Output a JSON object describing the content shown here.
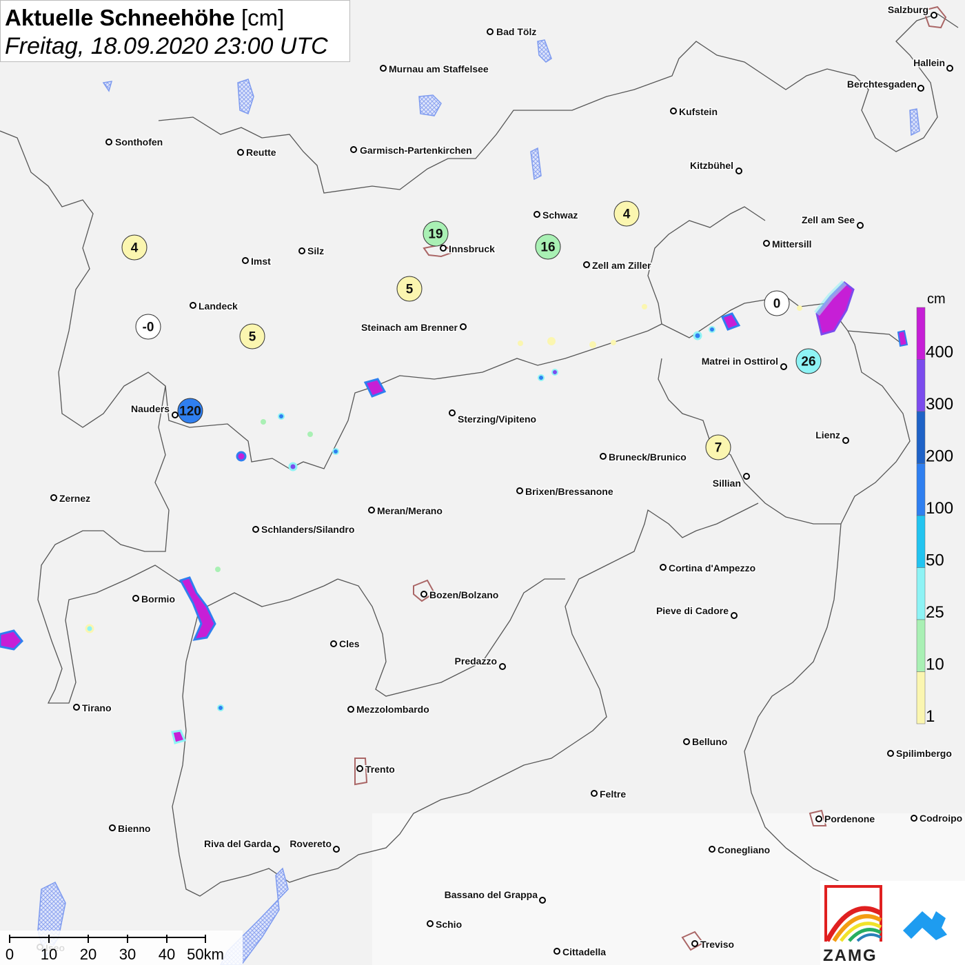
{
  "title": {
    "main_bold": "Aktuelle Schneehöhe",
    "main_unit": "[cm]",
    "subtitle": "Freitag, 18.09.2020 23:00 UTC"
  },
  "cities": [
    {
      "name": "Salzburg"
    },
    {
      "name": "Bad Tölz"
    },
    {
      "name": "Hallein"
    },
    {
      "name": "Murnau am Staffelsee"
    },
    {
      "name": "Berchtesgaden"
    },
    {
      "name": "Kufstein"
    },
    {
      "name": "Sonthofen"
    },
    {
      "name": "Reutte"
    },
    {
      "name": "Garmisch-Partenkirchen"
    },
    {
      "name": "Kitzbühel"
    },
    {
      "name": "Schwaz"
    },
    {
      "name": "Zell am See"
    },
    {
      "name": "Innsbruck"
    },
    {
      "name": "Mittersill"
    },
    {
      "name": "Silz"
    },
    {
      "name": "Imst"
    },
    {
      "name": "Zell am Ziller"
    },
    {
      "name": "Landeck"
    },
    {
      "name": "Steinach am Brenner"
    },
    {
      "name": "Matrei in Osttirol"
    },
    {
      "name": "Nauders"
    },
    {
      "name": "Sterzing/Vipiteno"
    },
    {
      "name": "Lienz"
    },
    {
      "name": "Bruneck/Brunico"
    },
    {
      "name": "Sillian"
    },
    {
      "name": "Zernez"
    },
    {
      "name": "Brixen/Bressanone"
    },
    {
      "name": "Meran/Merano"
    },
    {
      "name": "Schlanders/Silandro"
    },
    {
      "name": "Cortina d'Ampezzo"
    },
    {
      "name": "Bozen/Bolzano"
    },
    {
      "name": "Bormio"
    },
    {
      "name": "Pieve di Cadore"
    },
    {
      "name": "Cles"
    },
    {
      "name": "Predazzo"
    },
    {
      "name": "Tirano"
    },
    {
      "name": "Mezzolombardo"
    },
    {
      "name": "Belluno"
    },
    {
      "name": "Spilimbergo"
    },
    {
      "name": "Trento"
    },
    {
      "name": "Feltre"
    },
    {
      "name": "Pordenone"
    },
    {
      "name": "Codroipo"
    },
    {
      "name": "Bienno"
    },
    {
      "name": "Riva del Garda"
    },
    {
      "name": "Rovereto"
    },
    {
      "name": "Conegliano"
    },
    {
      "name": "Bassano del Grappa"
    },
    {
      "name": "Schio"
    },
    {
      "name": "Iseo"
    },
    {
      "name": "Treviso"
    },
    {
      "name": "Cittadella"
    }
  ],
  "stations": [
    {
      "value": "19",
      "color": "#a9f0b4"
    },
    {
      "value": "16",
      "color": "#a9f0b4"
    },
    {
      "value": "4",
      "color": "#fbf6b0"
    },
    {
      "value": "4",
      "color": "#fbf6b0"
    },
    {
      "value": "5",
      "color": "#fbf6b0"
    },
    {
      "value": "-0",
      "color": "#ffffff"
    },
    {
      "value": "5",
      "color": "#fbf6b0"
    },
    {
      "value": "0",
      "color": "#ffffff"
    },
    {
      "value": "26",
      "color": "#8ef3f5"
    },
    {
      "value": "120",
      "color": "#2f7ff0"
    },
    {
      "value": "7",
      "color": "#fbf6b0"
    }
  ],
  "legend": {
    "unit": "cm",
    "bins": [
      {
        "label": "400",
        "color": "#c61fd6"
      },
      {
        "label": "300",
        "color": "#7b4bed"
      },
      {
        "label": "200",
        "color": "#1e62c7"
      },
      {
        "label": "100",
        "color": "#2f7ff0"
      },
      {
        "label": "50",
        "color": "#22c4f0"
      },
      {
        "label": "25",
        "color": "#8ef3f5"
      },
      {
        "label": "10",
        "color": "#a9f0b4"
      },
      {
        "label": "1",
        "color": "#fbf6b0"
      }
    ]
  },
  "scale_bar": {
    "labels": [
      "0",
      "10",
      "20",
      "30",
      "40",
      "50km"
    ]
  },
  "logo": {
    "text": "ZAMG"
  }
}
